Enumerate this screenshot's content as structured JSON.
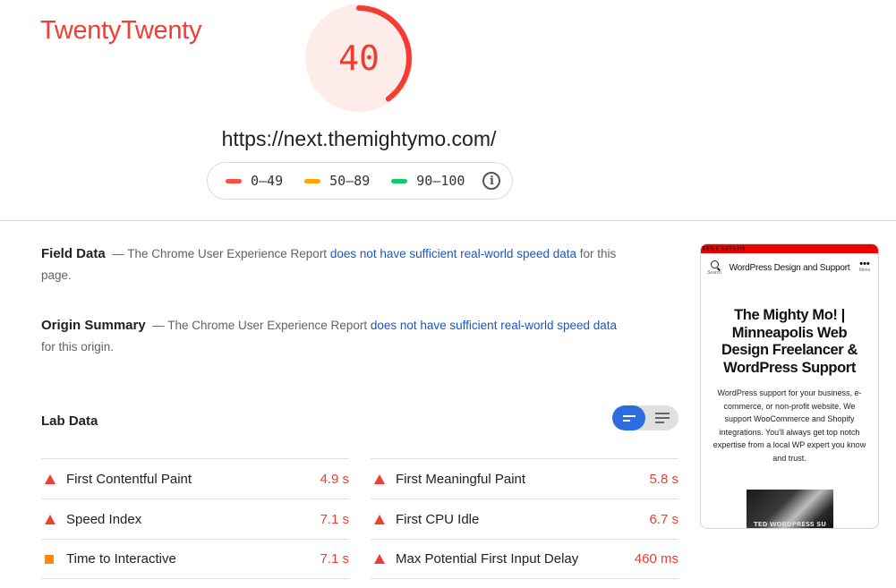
{
  "header": {
    "theme_title": "TwentyTwenty",
    "score": "40",
    "score_fraction": 0.4,
    "score_color": "#eb3f33",
    "url": "https://next.themightymo.com/"
  },
  "legend": {
    "items": [
      {
        "range": "0–49",
        "color": "#ff4e42"
      },
      {
        "range": "50–89",
        "color": "#ffa400"
      },
      {
        "range": "90–100",
        "color": "#0cce6b"
      }
    ],
    "info_icon": "info-icon"
  },
  "field_data": {
    "heading": "Field Data",
    "dash": "—",
    "text_before": "The Chrome User Experience Report",
    "link": "does not have sufficient real-world speed data",
    "text_after": "for this page."
  },
  "origin_summary": {
    "heading": "Origin Summary",
    "dash": "—",
    "text_before": "The Chrome User Experience Report",
    "link": "does not have sufficient real-world speed data",
    "text_after": "for this origin."
  },
  "lab_data": {
    "heading": "Lab Data",
    "view_toggle": [
      "compact-view-icon",
      "list-view-icon"
    ],
    "left_metrics": [
      {
        "label": "First Contentful Paint",
        "value": "4.9 s",
        "status": "fail"
      },
      {
        "label": "Speed Index",
        "value": "7.1 s",
        "status": "fail"
      },
      {
        "label": "Time to Interactive",
        "value": "7.1 s",
        "status": "average"
      }
    ],
    "right_metrics": [
      {
        "label": "First Meaningful Paint",
        "value": "5.8 s",
        "status": "fail"
      },
      {
        "label": "First CPU Idle",
        "value": "6.7 s",
        "status": "fail"
      },
      {
        "label": "Max Potential First Input Delay",
        "value": "460 ms",
        "status": "fail"
      }
    ]
  },
  "screenshot": {
    "banner": "TEST SITE!!!",
    "search_label": "Search",
    "site_name": "WordPress Design and Support",
    "menu_label": "Menu",
    "headline": "The Mighty Mo! | Minneapolis Web Design Freelancer & WordPress Support",
    "body": "WordPress support for your business, e-commerce, or non-profit website. We support WooCommerce and Shopify integrations. You'll always get top notch expertise from a local WP expert you know and trust.",
    "image_caption": "TED WORDPRESS SU"
  }
}
